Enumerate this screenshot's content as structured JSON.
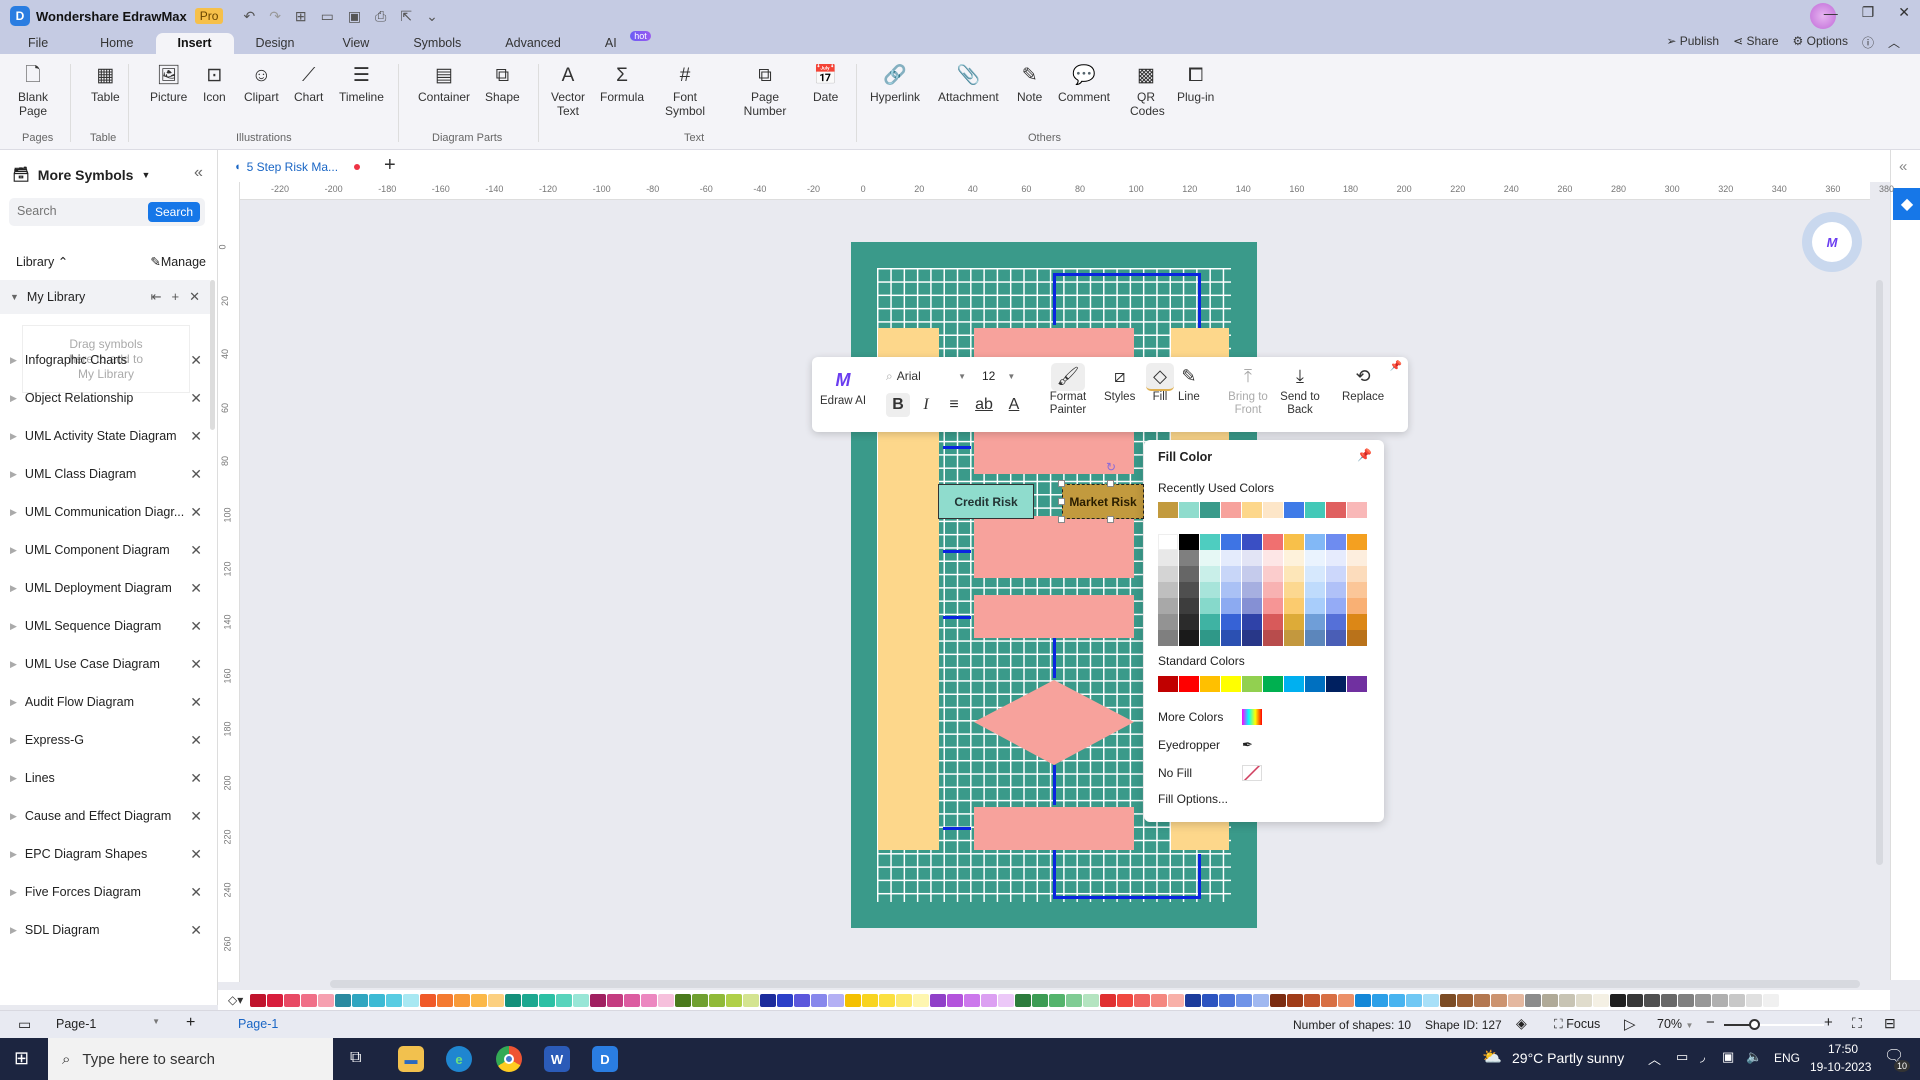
{
  "app": {
    "title": "Wondershare EdrawMax",
    "badge": "Pro"
  },
  "menu": {
    "tabs": [
      {
        "label": "File"
      },
      {
        "label": "Home"
      },
      {
        "label": "Insert"
      },
      {
        "label": "Design"
      },
      {
        "label": "View"
      },
      {
        "label": "Symbols"
      },
      {
        "label": "Advanced"
      },
      {
        "label": "AI"
      }
    ],
    "active": "Insert",
    "ai_badge": "hot",
    "right": {
      "publish": "Publish",
      "share": "Share",
      "options": "Options"
    }
  },
  "ribbon": {
    "buttons": [
      {
        "label": "Blank Page",
        "icon": "blank-page-icon"
      },
      {
        "label": "Table",
        "icon": "table-icon"
      },
      {
        "label": "Picture",
        "icon": "picture-icon"
      },
      {
        "label": "Icon",
        "icon": "icon-icon"
      },
      {
        "label": "Clipart",
        "icon": "clipart-icon"
      },
      {
        "label": "Chart",
        "icon": "chart-icon"
      },
      {
        "label": "Timeline",
        "icon": "timeline-icon"
      },
      {
        "label": "Container",
        "icon": "container-icon"
      },
      {
        "label": "Shape",
        "icon": "shape-icon"
      },
      {
        "label": "Vector Text",
        "icon": "vector-text-icon"
      },
      {
        "label": "Formula",
        "icon": "formula-icon"
      },
      {
        "label": "Font Symbol",
        "icon": "font-symbol-icon"
      },
      {
        "label": "Page Number",
        "icon": "page-number-icon"
      },
      {
        "label": "Date",
        "icon": "date-icon"
      },
      {
        "label": "Hyperlink",
        "icon": "hyperlink-icon"
      },
      {
        "label": "Attachment",
        "icon": "attachment-icon"
      },
      {
        "label": "Note",
        "icon": "note-icon"
      },
      {
        "label": "Comment",
        "icon": "comment-icon"
      },
      {
        "label": "QR Codes",
        "icon": "qr-codes-icon"
      },
      {
        "label": "Plug-in",
        "icon": "plug-in-icon"
      }
    ],
    "groups": [
      "Pages",
      "Table",
      "Illustrations",
      "Diagram Parts",
      "Text",
      "Others"
    ]
  },
  "left_panel": {
    "title": "More Symbols",
    "search_placeholder": "Search",
    "search_button": "Search",
    "library_label": "Library",
    "manage_label": "Manage",
    "my_library": "My Library",
    "drop_hint_1": "Drag symbols",
    "drop_hint_2": "here to add to",
    "drop_hint_3": "My Library",
    "libraries": [
      "Infographic Charts",
      "Object Relationship",
      "UML Activity State Diagram",
      "UML Class Diagram",
      "UML Communication Diagr...",
      "UML Component Diagram",
      "UML Deployment Diagram",
      "UML Sequence Diagram",
      "UML Use Case Diagram",
      "Audit Flow Diagram",
      "Express-G",
      "Lines",
      "Cause and Effect Diagram",
      "EPC Diagram Shapes",
      "Five Forces Diagram",
      "SDL Diagram"
    ]
  },
  "document": {
    "tab": "5 Step Risk Ma...",
    "unsaved": true
  },
  "ruler": {
    "h": [
      "-220",
      "-200",
      "-180",
      "-160",
      "-140",
      "-120",
      "-100",
      "-80",
      "-60",
      "-40",
      "-20",
      "0",
      "20",
      "40",
      "60",
      "80",
      "100",
      "120",
      "140",
      "160",
      "180",
      "200",
      "220",
      "240",
      "260",
      "280",
      "300",
      "320",
      "340",
      "360",
      "380"
    ],
    "v": [
      "0",
      "20",
      "40",
      "60",
      "80",
      "100",
      "120",
      "140",
      "160",
      "180",
      "200",
      "220",
      "240",
      "260"
    ]
  },
  "diagram": {
    "shapes": {
      "credit_risk": "Credit Risk",
      "market_risk": "Market Risk"
    },
    "colors": {
      "page": "#3a9a8a",
      "pink": "#f7a29c",
      "yellow": "#fdd78b",
      "mint": "#8fdccd",
      "gold": "#c29a3e",
      "connector": "#0a24e0"
    }
  },
  "float_toolbar": {
    "edraw_ai": "Edraw AI",
    "font": "Arial",
    "size": "12",
    "format_painter": "Format Painter",
    "styles": "Styles",
    "fill": "Fill",
    "line": "Line",
    "bring_to_front": "Bring to Front",
    "send_to_back": "Send to Back",
    "replace": "Replace"
  },
  "fill_popup": {
    "title": "Fill Color",
    "recent_label": "Recently Used Colors",
    "recent": [
      "#c29a3e",
      "#8fdccd",
      "#3a9a8a",
      "#f7a29c",
      "#fdd78b",
      "#fde6c8",
      "#3f7be8",
      "#43c9b8",
      "#e06060",
      "#f9b8b8"
    ],
    "theme_top": [
      "#ffffff",
      "#000000",
      "#4ecdc0",
      "#3e74e4",
      "#3a4fc4",
      "#f07070",
      "#f8c04a",
      "#82b8f6",
      "#6e8cf0",
      "#f4a020"
    ],
    "theme_columns": [
      [
        "#e8e8e8",
        "#d4d4d4",
        "#bfbfbf",
        "#a8a8a8",
        "#939393",
        "#7f7f7f"
      ],
      [
        "#7f7f7f",
        "#666666",
        "#4f4f4f",
        "#3d3d3d",
        "#2b2b2b",
        "#1a1a1a"
      ],
      [
        "#e6f8f5",
        "#c9efe9",
        "#a7e4da",
        "#86d9cb",
        "#3fb3a3",
        "#2f9888"
      ],
      [
        "#e4ebfc",
        "#c8d6f8",
        "#aac1f5",
        "#8caaf1",
        "#3662d6",
        "#2b50b2"
      ],
      [
        "#e2e4f5",
        "#c5cbec",
        "#a6afe0",
        "#8590d4",
        "#2f42a8",
        "#283788"
      ],
      [
        "#fde6e6",
        "#fbcccc",
        "#f8b2b2",
        "#f69595",
        "#d85a5a",
        "#b84c4c"
      ],
      [
        "#fef2db",
        "#fde6b8",
        "#fcd890",
        "#fbcb6e",
        "#ddab38",
        "#c3983e"
      ],
      [
        "#eaf3fe",
        "#d6e8fd",
        "#bfdbfc",
        "#a8cdfb",
        "#6f9ed8",
        "#5c86bb"
      ],
      [
        "#e6ebfd",
        "#ccd7fb",
        "#b0c1f8",
        "#94abf6",
        "#5570d8",
        "#4a5eb6"
      ],
      [
        "#fdeede",
        "#fcdcbc",
        "#fbc698",
        "#f9b074",
        "#dc8716",
        "#b9721a"
      ]
    ],
    "standard_label": "Standard Colors",
    "standard": [
      "#c00000",
      "#ff0000",
      "#ffc000",
      "#ffff00",
      "#92d050",
      "#00b050",
      "#00b0f0",
      "#0070c0",
      "#002060",
      "#7030a0"
    ],
    "more_colors": "More Colors",
    "eyedropper": "Eyedropper",
    "no_fill": "No Fill",
    "fill_options": "Fill Options..."
  },
  "palette": [
    "#c0142c",
    "#d81e3c",
    "#e84a64",
    "#f07088",
    "#f6a0b0",
    "#2a8aa0",
    "#30a6c0",
    "#3cbad4",
    "#58cce2",
    "#a8e8f2",
    "#f05a28",
    "#f47a30",
    "#f89a38",
    "#fbb848",
    "#fcd080",
    "#14907a",
    "#1ca890",
    "#2cc0a4",
    "#58d4bc",
    "#98e6d6",
    "#a02060",
    "#c43c80",
    "#dc5ca0",
    "#ec88c0",
    "#f6c0dc",
    "#4a7a1c",
    "#70a030",
    "#90ba38",
    "#b0d048",
    "#d4e490",
    "#1c2c9c",
    "#2c40c8",
    "#5c58dc",
    "#8888ec",
    "#b4b0f4",
    "#f4c000",
    "#f8d420",
    "#fbe040",
    "#fcea70",
    "#fef6b0",
    "#9040c8",
    "#b454dc",
    "#cc78ec",
    "#dca0f2",
    "#ecc8f8",
    "#2c7c3c",
    "#3c9c54",
    "#54b46c",
    "#80cc94",
    "#b4e4c0",
    "#e03030",
    "#f04840",
    "#f06460",
    "#f48880",
    "#f8b0a8",
    "#1c3c9c",
    "#2c54c0",
    "#4c74d8",
    "#7094e8",
    "#a0b8f0",
    "#7c2c10",
    "#a03c18",
    "#c0542c",
    "#d87044",
    "#ec9068",
    "#1488d8",
    "#2ca0e8",
    "#48b4f0",
    "#70c8f4",
    "#a8e0f8",
    "#7c4c24",
    "#9c6034",
    "#b47850",
    "#cc9470",
    "#e4b8a0",
    "#8c8c8c",
    "#b0aa98",
    "#c8c4b4",
    "#e0dccc",
    "#f4f0e4",
    "#202020",
    "#383838",
    "#505050",
    "#686868",
    "#808080",
    "#989898",
    "#b0b0b0",
    "#c8c8c8",
    "#e0e0e0",
    "#f0f0f0"
  ],
  "statusbar": {
    "page_selector": "Page-1",
    "page_tab": "Page-1",
    "shapes": "Number of shapes: 10",
    "shape_id": "Shape ID: 127",
    "focus": "Focus",
    "zoom": "70%",
    "zoom_fraction": 0.3
  },
  "taskbar": {
    "search_placeholder": "Type here to search",
    "weather": "29°C  Partly sunny",
    "lang": "ENG",
    "time": "17:50",
    "date": "19-10-2023",
    "notifications": "10"
  }
}
